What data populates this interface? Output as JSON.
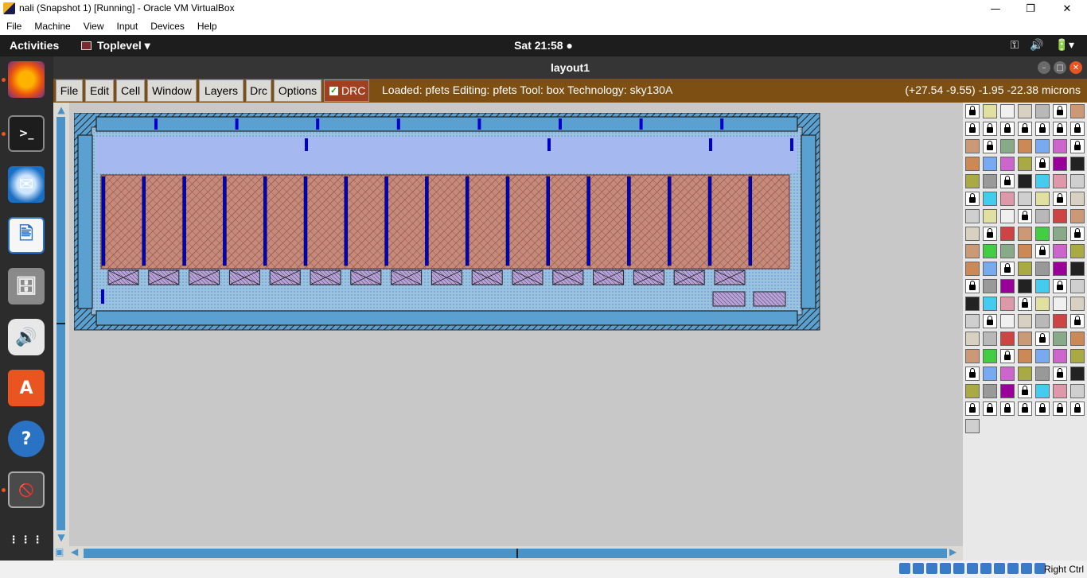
{
  "host_window": {
    "title": "nali (Snapshot 1) [Running] - Oracle VM VirtualBox",
    "controls": {
      "minimize": "—",
      "restore": "❐",
      "close": "✕"
    },
    "menu": [
      "File",
      "Machine",
      "View",
      "Input",
      "Devices",
      "Help"
    ]
  },
  "gnome_panel": {
    "activities": "Activities",
    "app_menu": "Toplevel ▾",
    "clock": "Sat 21:58 ●",
    "tray": [
      "⚿",
      "🔊",
      "🔋▾"
    ]
  },
  "dock": {
    "items": [
      {
        "name": "firefox-icon",
        "glyph": "🦊",
        "running": true
      },
      {
        "name": "terminal-icon",
        "glyph": ">_",
        "running": true
      },
      {
        "name": "thunderbird-icon",
        "glyph": "✉",
        "running": false
      },
      {
        "name": "writer-icon",
        "glyph": "🖹",
        "running": false
      },
      {
        "name": "files-icon",
        "glyph": "🗄",
        "running": false
      },
      {
        "name": "rhythmbox-icon",
        "glyph": "🔊",
        "running": false
      },
      {
        "name": "software-icon",
        "glyph": "A",
        "running": false
      },
      {
        "name": "help-icon",
        "glyph": "?",
        "running": false
      },
      {
        "name": "magic-app-icon",
        "glyph": "🚫",
        "running": true
      },
      {
        "name": "show-apps-icon",
        "glyph": "⋮⋮⋮",
        "running": false
      }
    ]
  },
  "magic_window": {
    "title": "layout1",
    "menu": [
      "File",
      "Edit",
      "Cell",
      "Window",
      "Layers",
      "Drc",
      "Options"
    ],
    "drc_toggle": {
      "label": "DRC",
      "checked": true
    },
    "status": "Loaded: pfets Editing: pfets Tool: box  Technology: sky130A",
    "coords": "(+27.54 -9.55) -1.95 -22.38 microns"
  },
  "layout": {
    "finger_count": 17,
    "colors": {
      "nwell": "#98c4e0",
      "diff": "#c48a7a",
      "poly_contact": "#9898e8",
      "metal": "#0000cc",
      "guard_ring": "#5aa0d0"
    }
  },
  "palette": {
    "rows": 19,
    "cols": 7
  },
  "vbox_status": {
    "host_key": "Right Ctrl"
  }
}
